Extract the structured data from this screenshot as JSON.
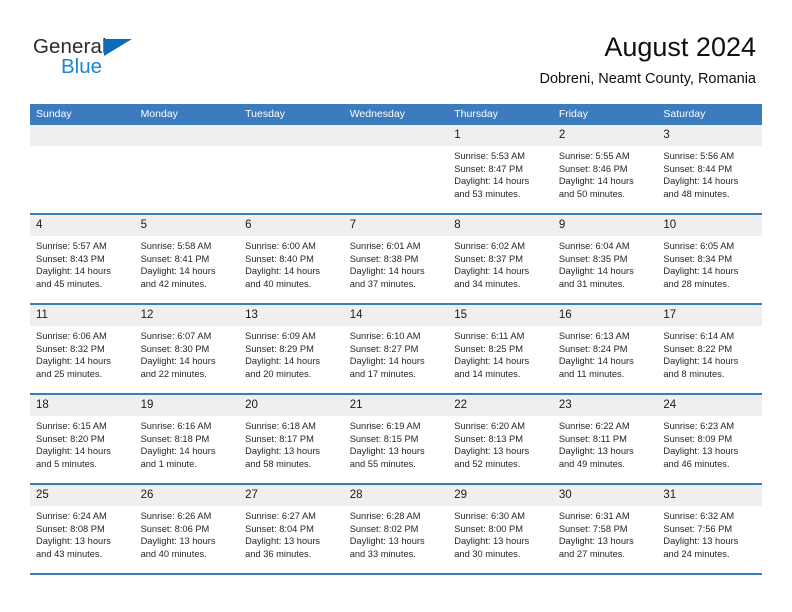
{
  "brand": {
    "name_top": "General",
    "name_bottom": "Blue",
    "triangle_color": "#0a6cbb",
    "blue_color": "#1b85d6"
  },
  "header": {
    "title": "August 2024",
    "subtitle": "Dobreni, Neamt County, Romania"
  },
  "theme": {
    "header_blue": "#3b7cbe",
    "row_separator": "#3b7cbe",
    "daynum_band": "#efefef",
    "text": "#262626"
  },
  "calendar": {
    "weekday_headers": [
      "Sunday",
      "Monday",
      "Tuesday",
      "Wednesday",
      "Thursday",
      "Friday",
      "Saturday"
    ],
    "weeks": [
      [
        {
          "day": "",
          "lines": []
        },
        {
          "day": "",
          "lines": []
        },
        {
          "day": "",
          "lines": []
        },
        {
          "day": "",
          "lines": []
        },
        {
          "day": "1",
          "lines": [
            "Sunrise: 5:53 AM",
            "Sunset: 8:47 PM",
            "Daylight: 14 hours",
            "and 53 minutes."
          ]
        },
        {
          "day": "2",
          "lines": [
            "Sunrise: 5:55 AM",
            "Sunset: 8:46 PM",
            "Daylight: 14 hours",
            "and 50 minutes."
          ]
        },
        {
          "day": "3",
          "lines": [
            "Sunrise: 5:56 AM",
            "Sunset: 8:44 PM",
            "Daylight: 14 hours",
            "and 48 minutes."
          ]
        }
      ],
      [
        {
          "day": "4",
          "lines": [
            "Sunrise: 5:57 AM",
            "Sunset: 8:43 PM",
            "Daylight: 14 hours",
            "and 45 minutes."
          ]
        },
        {
          "day": "5",
          "lines": [
            "Sunrise: 5:58 AM",
            "Sunset: 8:41 PM",
            "Daylight: 14 hours",
            "and 42 minutes."
          ]
        },
        {
          "day": "6",
          "lines": [
            "Sunrise: 6:00 AM",
            "Sunset: 8:40 PM",
            "Daylight: 14 hours",
            "and 40 minutes."
          ]
        },
        {
          "day": "7",
          "lines": [
            "Sunrise: 6:01 AM",
            "Sunset: 8:38 PM",
            "Daylight: 14 hours",
            "and 37 minutes."
          ]
        },
        {
          "day": "8",
          "lines": [
            "Sunrise: 6:02 AM",
            "Sunset: 8:37 PM",
            "Daylight: 14 hours",
            "and 34 minutes."
          ]
        },
        {
          "day": "9",
          "lines": [
            "Sunrise: 6:04 AM",
            "Sunset: 8:35 PM",
            "Daylight: 14 hours",
            "and 31 minutes."
          ]
        },
        {
          "day": "10",
          "lines": [
            "Sunrise: 6:05 AM",
            "Sunset: 8:34 PM",
            "Daylight: 14 hours",
            "and 28 minutes."
          ]
        }
      ],
      [
        {
          "day": "11",
          "lines": [
            "Sunrise: 6:06 AM",
            "Sunset: 8:32 PM",
            "Daylight: 14 hours",
            "and 25 minutes."
          ]
        },
        {
          "day": "12",
          "lines": [
            "Sunrise: 6:07 AM",
            "Sunset: 8:30 PM",
            "Daylight: 14 hours",
            "and 22 minutes."
          ]
        },
        {
          "day": "13",
          "lines": [
            "Sunrise: 6:09 AM",
            "Sunset: 8:29 PM",
            "Daylight: 14 hours",
            "and 20 minutes."
          ]
        },
        {
          "day": "14",
          "lines": [
            "Sunrise: 6:10 AM",
            "Sunset: 8:27 PM",
            "Daylight: 14 hours",
            "and 17 minutes."
          ]
        },
        {
          "day": "15",
          "lines": [
            "Sunrise: 6:11 AM",
            "Sunset: 8:25 PM",
            "Daylight: 14 hours",
            "and 14 minutes."
          ]
        },
        {
          "day": "16",
          "lines": [
            "Sunrise: 6:13 AM",
            "Sunset: 8:24 PM",
            "Daylight: 14 hours",
            "and 11 minutes."
          ]
        },
        {
          "day": "17",
          "lines": [
            "Sunrise: 6:14 AM",
            "Sunset: 8:22 PM",
            "Daylight: 14 hours",
            "and 8 minutes."
          ]
        }
      ],
      [
        {
          "day": "18",
          "lines": [
            "Sunrise: 6:15 AM",
            "Sunset: 8:20 PM",
            "Daylight: 14 hours",
            "and 5 minutes."
          ]
        },
        {
          "day": "19",
          "lines": [
            "Sunrise: 6:16 AM",
            "Sunset: 8:18 PM",
            "Daylight: 14 hours",
            "and 1 minute."
          ]
        },
        {
          "day": "20",
          "lines": [
            "Sunrise: 6:18 AM",
            "Sunset: 8:17 PM",
            "Daylight: 13 hours",
            "and 58 minutes."
          ]
        },
        {
          "day": "21",
          "lines": [
            "Sunrise: 6:19 AM",
            "Sunset: 8:15 PM",
            "Daylight: 13 hours",
            "and 55 minutes."
          ]
        },
        {
          "day": "22",
          "lines": [
            "Sunrise: 6:20 AM",
            "Sunset: 8:13 PM",
            "Daylight: 13 hours",
            "and 52 minutes."
          ]
        },
        {
          "day": "23",
          "lines": [
            "Sunrise: 6:22 AM",
            "Sunset: 8:11 PM",
            "Daylight: 13 hours",
            "and 49 minutes."
          ]
        },
        {
          "day": "24",
          "lines": [
            "Sunrise: 6:23 AM",
            "Sunset: 8:09 PM",
            "Daylight: 13 hours",
            "and 46 minutes."
          ]
        }
      ],
      [
        {
          "day": "25",
          "lines": [
            "Sunrise: 6:24 AM",
            "Sunset: 8:08 PM",
            "Daylight: 13 hours",
            "and 43 minutes."
          ]
        },
        {
          "day": "26",
          "lines": [
            "Sunrise: 6:26 AM",
            "Sunset: 8:06 PM",
            "Daylight: 13 hours",
            "and 40 minutes."
          ]
        },
        {
          "day": "27",
          "lines": [
            "Sunrise: 6:27 AM",
            "Sunset: 8:04 PM",
            "Daylight: 13 hours",
            "and 36 minutes."
          ]
        },
        {
          "day": "28",
          "lines": [
            "Sunrise: 6:28 AM",
            "Sunset: 8:02 PM",
            "Daylight: 13 hours",
            "and 33 minutes."
          ]
        },
        {
          "day": "29",
          "lines": [
            "Sunrise: 6:30 AM",
            "Sunset: 8:00 PM",
            "Daylight: 13 hours",
            "and 30 minutes."
          ]
        },
        {
          "day": "30",
          "lines": [
            "Sunrise: 6:31 AM",
            "Sunset: 7:58 PM",
            "Daylight: 13 hours",
            "and 27 minutes."
          ]
        },
        {
          "day": "31",
          "lines": [
            "Sunrise: 6:32 AM",
            "Sunset: 7:56 PM",
            "Daylight: 13 hours",
            "and 24 minutes."
          ]
        }
      ]
    ]
  }
}
